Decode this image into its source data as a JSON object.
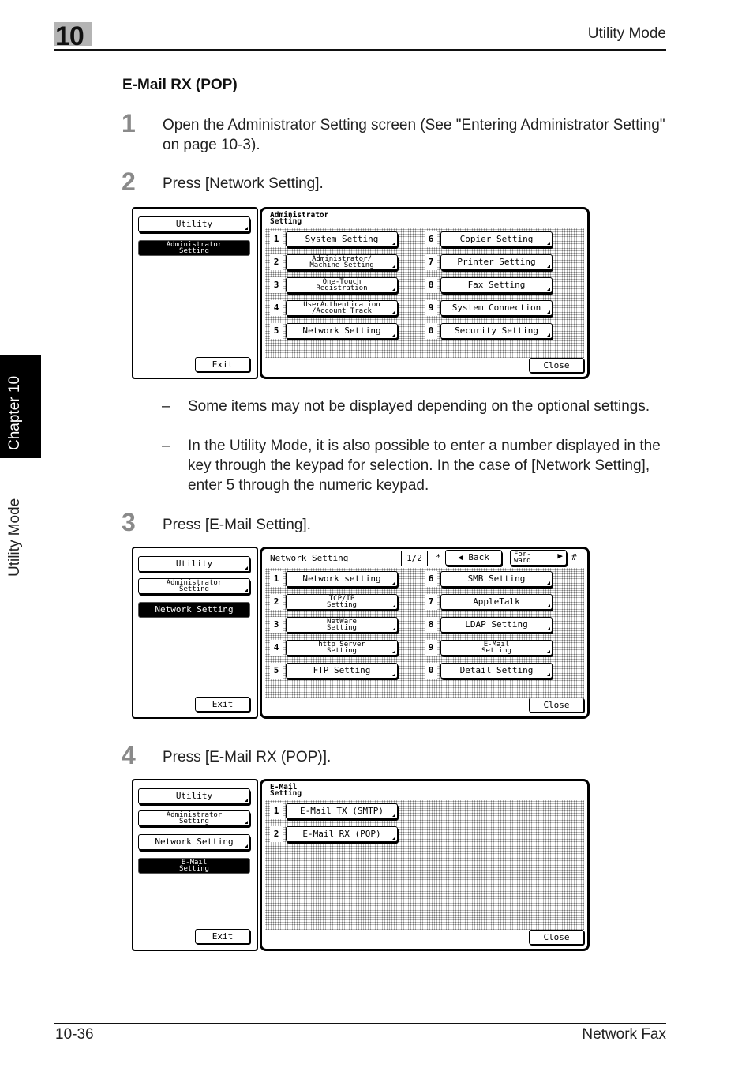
{
  "header": {
    "chapter_number": "10",
    "title": "Utility Mode"
  },
  "side": {
    "chapter_tab": "Chapter 10",
    "mode_label": "Utility Mode"
  },
  "section": {
    "title": "E-Mail RX (POP)"
  },
  "steps": [
    {
      "number": "1",
      "text": "Open the Administrator Setting screen (See \"Entering Administrator Setting\" on page 10-3)."
    },
    {
      "number": "2",
      "text": "Press [Network Setting]."
    },
    {
      "number": "3",
      "text": "Press [E-Mail Setting]."
    },
    {
      "number": "4",
      "text": "Press [E-Mail RX (POP)]."
    }
  ],
  "notes": [
    {
      "dash": "–",
      "text": "Some items may not be displayed depending on the optional settings."
    },
    {
      "dash": "–",
      "text": "In the Utility Mode, it is also possible to enter a number displayed in the key through the keypad for selection. In the case of [Network Setting], enter 5 through the numeric keypad."
    }
  ],
  "screens": [
    {
      "left": [
        "Utility",
        "Administrator\nSetting"
      ],
      "title": "Administrator\nSetting",
      "exit": "Exit",
      "close": "Close",
      "buttons": [
        {
          "num": "1",
          "label": "System Setting"
        },
        {
          "num": "2",
          "label": "Administrator/\nMachine Setting"
        },
        {
          "num": "3",
          "label": "One-Touch\nRegistration"
        },
        {
          "num": "4",
          "label": "UserAuthentication\n/Account Track"
        },
        {
          "num": "5",
          "label": "Network Setting"
        },
        {
          "num": "6",
          "label": "Copier Setting"
        },
        {
          "num": "7",
          "label": "Printer Setting"
        },
        {
          "num": "8",
          "label": "Fax Setting"
        },
        {
          "num": "9",
          "label": "System Connection"
        },
        {
          "num": "0",
          "label": "Security Setting"
        }
      ]
    },
    {
      "left": [
        "Utility",
        "Administrator\nSetting",
        "Network Setting"
      ],
      "title": "Network Setting",
      "page": "1/2",
      "star": "*",
      "hash": "#",
      "back": "Back",
      "forward": "For-\nward",
      "exit": "Exit",
      "close": "Close",
      "buttons": [
        {
          "num": "1",
          "label": "Network setting"
        },
        {
          "num": "2",
          "label": "TCP/IP\nSetting"
        },
        {
          "num": "3",
          "label": "NetWare\nSetting"
        },
        {
          "num": "4",
          "label": "http Server\nSetting"
        },
        {
          "num": "5",
          "label": "FTP Setting"
        },
        {
          "num": "6",
          "label": "SMB Setting"
        },
        {
          "num": "7",
          "label": "AppleTalk"
        },
        {
          "num": "8",
          "label": "LDAP Setting"
        },
        {
          "num": "9",
          "label": "E-Mail\nSetting"
        },
        {
          "num": "0",
          "label": "Detail Setting"
        }
      ]
    },
    {
      "left": [
        "Utility",
        "Administrator\nSetting",
        "Network Setting",
        "E-Mail\nSetting"
      ],
      "title": "E-Mail\nSetting",
      "exit": "Exit",
      "close": "Close",
      "buttons": [
        {
          "num": "1",
          "label": "E-Mail TX (SMTP)"
        },
        {
          "num": "2",
          "label": "E-Mail RX (POP)"
        }
      ]
    }
  ],
  "footer": {
    "page": "10-36",
    "title": "Network Fax"
  }
}
